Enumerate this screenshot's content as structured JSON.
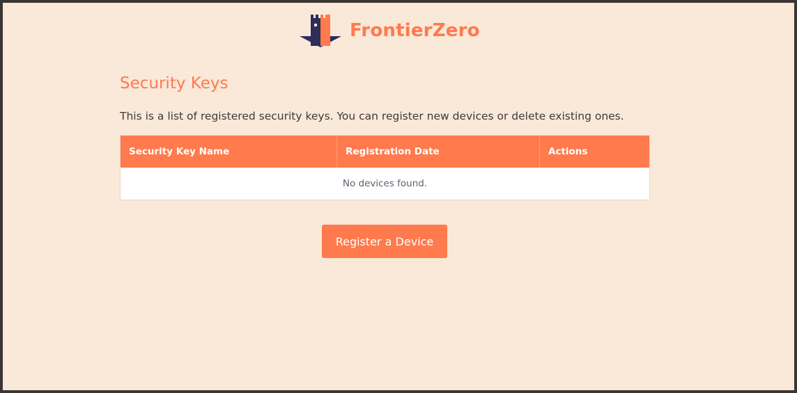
{
  "brand": {
    "name": "FrontierZero",
    "logo_icon": "castle-tower-logo"
  },
  "main": {
    "title": "Security Keys",
    "description": "This is a list of registered security keys. You can register new devices or delete existing ones.",
    "table": {
      "columns": [
        "Security Key Name",
        "Registration Date",
        "Actions"
      ],
      "rows": [],
      "empty_message": "No devices found."
    },
    "register_button_label": "Register a Device"
  },
  "colors": {
    "accent": "#ff7a4d",
    "background": "#fae8d9",
    "logo_dark": "#2b2e5a"
  }
}
